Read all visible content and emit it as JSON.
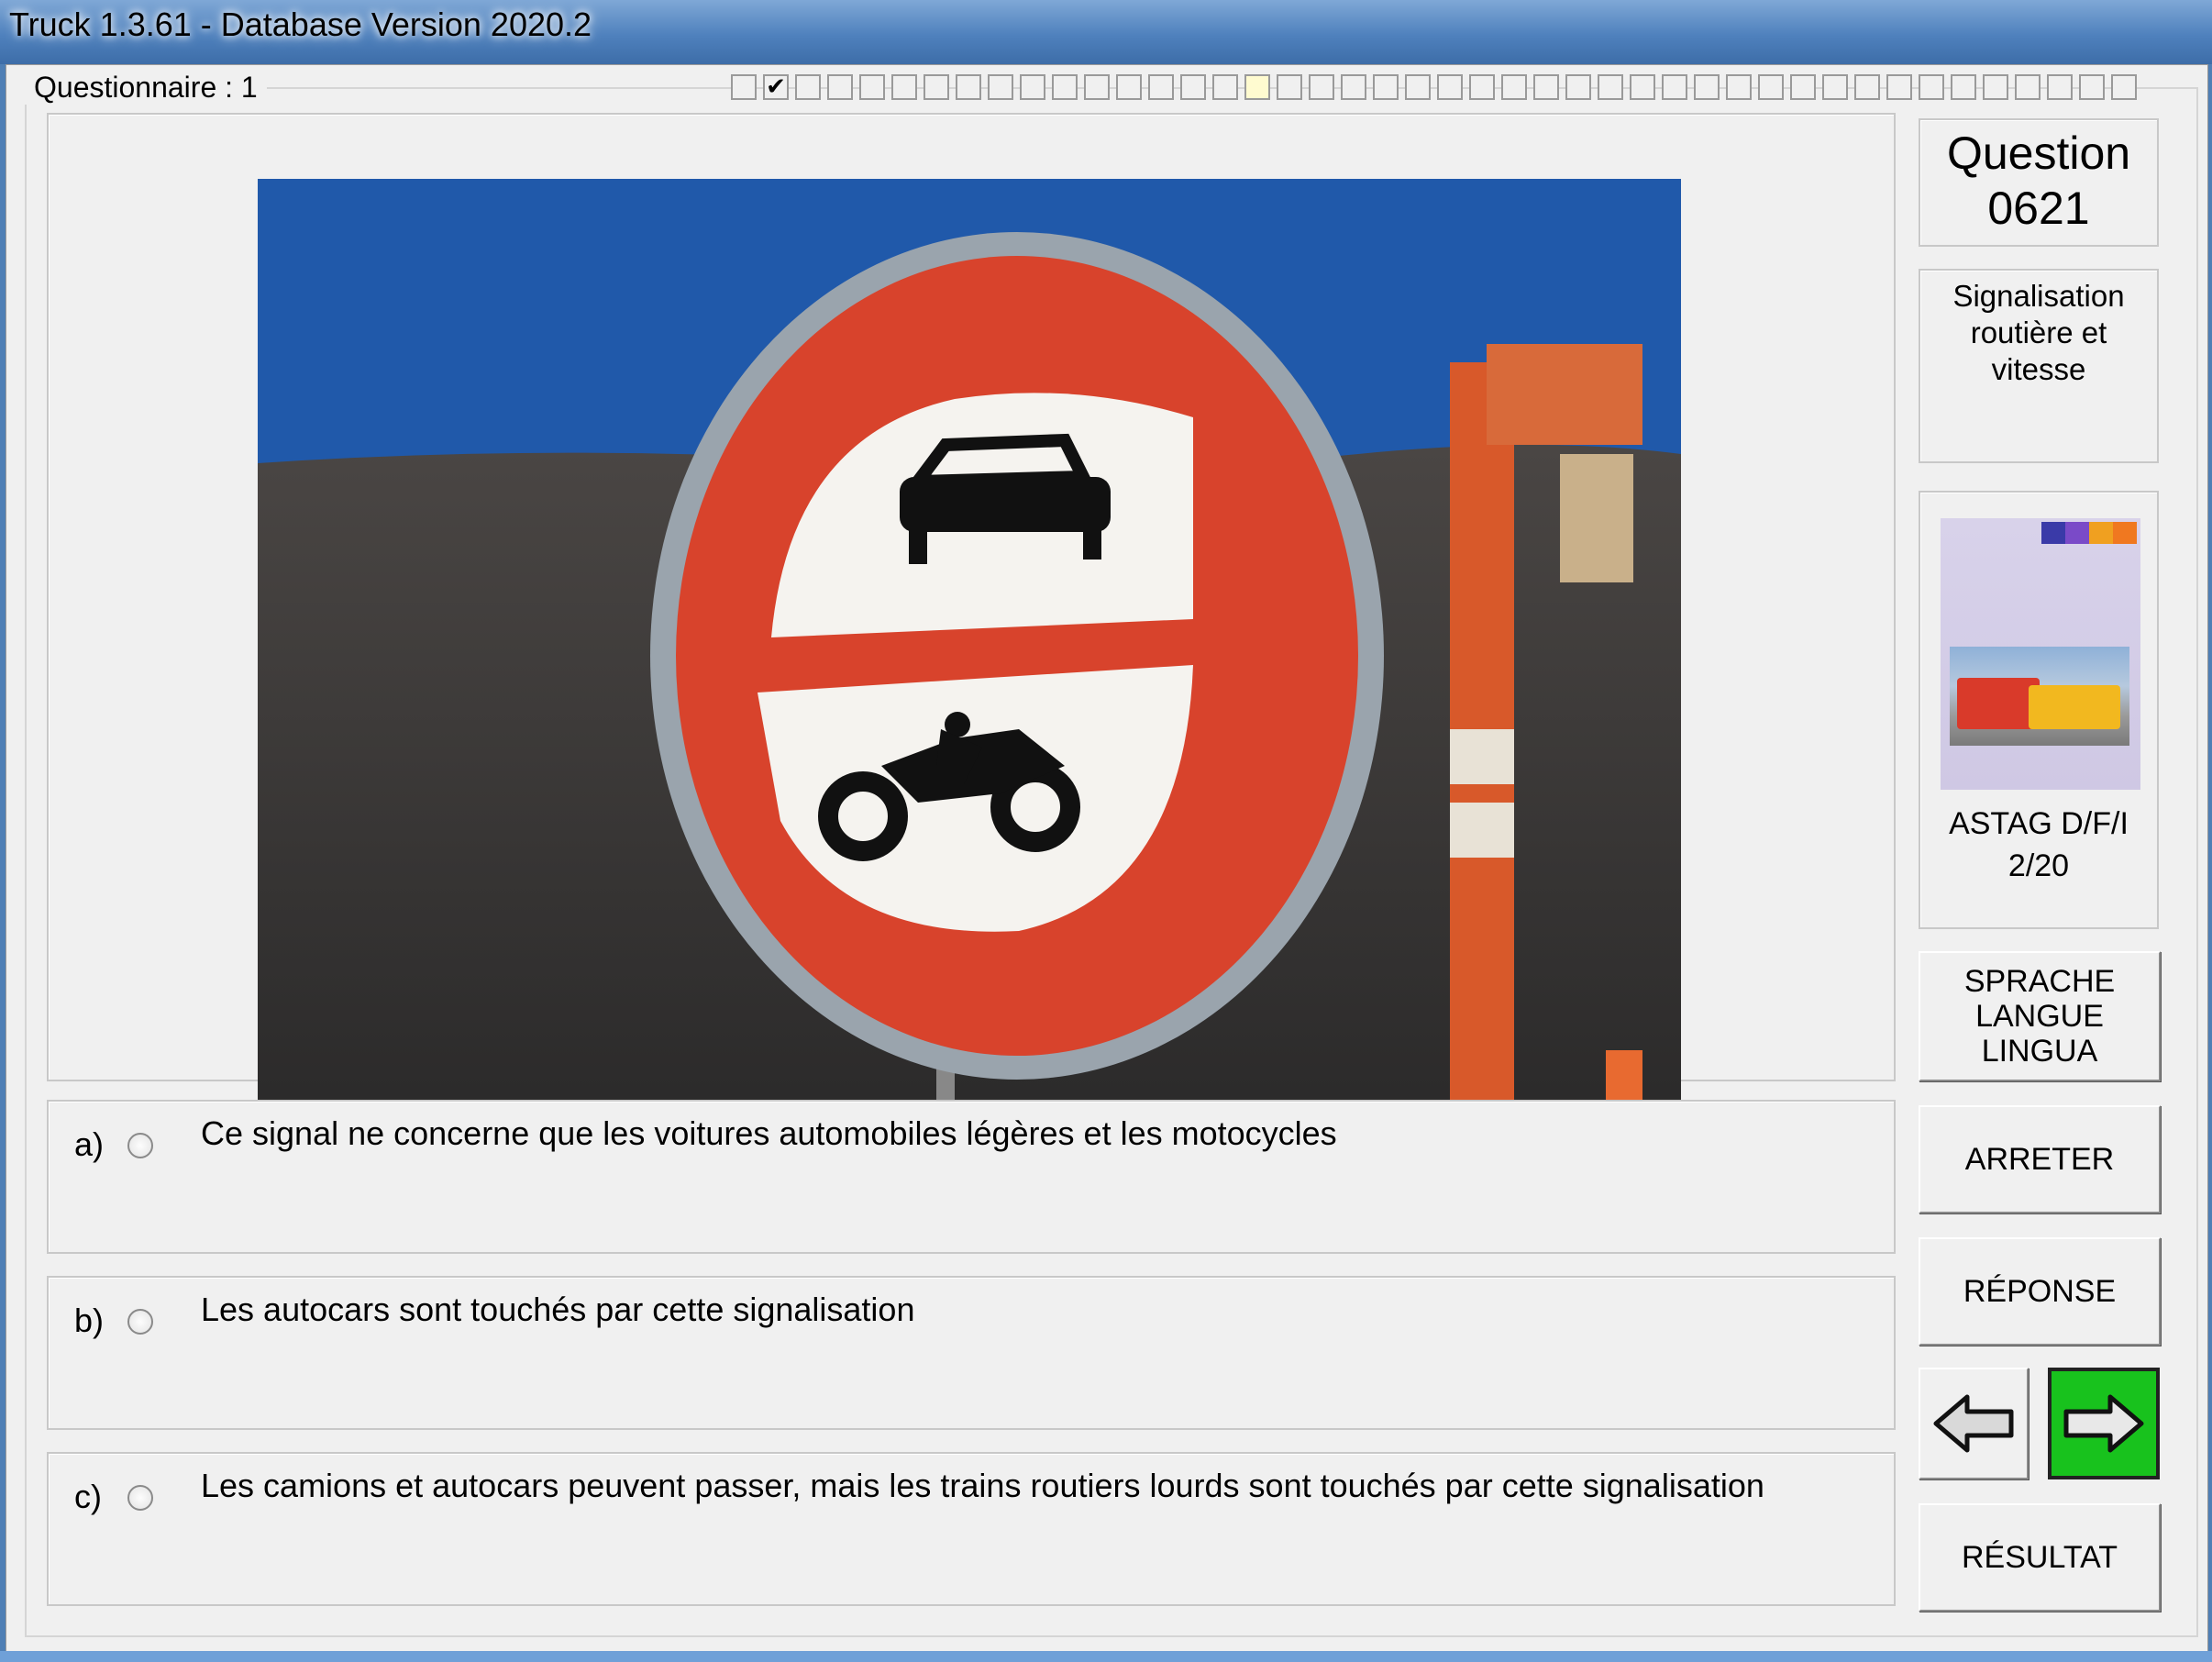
{
  "window": {
    "title": "Truck 1.3.61 - Database Version 2020.2"
  },
  "questionnaire": {
    "label": "Questionnaire : 1",
    "boxes": [
      "",
      "✔",
      "",
      "",
      "",
      "",
      "",
      "",
      "",
      "",
      "",
      "",
      "",
      "",
      "",
      "",
      "",
      "",
      "",
      "",
      "",
      "",
      "",
      "",
      "",
      "",
      "",
      "",
      "",
      "",
      "",
      "",
      "",
      "",
      "",
      "",
      "",
      "",
      "",
      "",
      "",
      "",
      "",
      ""
    ],
    "current_index": 16
  },
  "question": {
    "label": "Question",
    "number": "0621"
  },
  "category": {
    "text": "Signalisation routière et vitesse"
  },
  "book": {
    "name": "ASTAG D/F/I",
    "page": "2/20"
  },
  "answers": [
    {
      "letter": "a)",
      "text": "Ce signal ne concerne que les voitures automobiles légères et les motocycles"
    },
    {
      "letter": "b)",
      "text": "Les autocars sont touchés par cette signalisation"
    },
    {
      "letter": "c)",
      "text": "Les camions et autocars peuvent passer, mais les trains routiers lourds sont touchés par cette signalisation"
    }
  ],
  "buttons": {
    "language": "SPRACHE\nLANGUE\nLINGUA",
    "stop": "ARRETER",
    "answer": "RÉPONSE",
    "result": "RÉSULTAT"
  },
  "icons": {
    "prev": "arrow-left-icon",
    "next": "arrow-right-icon",
    "next_bg_color": "#18c21d",
    "sign_red": "#d8432c"
  }
}
